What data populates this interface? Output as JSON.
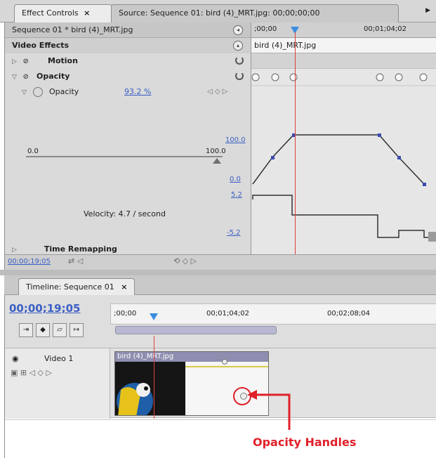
{
  "top_tabs": {
    "active_label": "Effect Controls",
    "active_close": "×",
    "inactive_label": "Source: Sequence 01: bird (4)_MRT.jpg: 00;00;00;00"
  },
  "effect_controls": {
    "sequence_label": "Sequence 01 * bird (4)_MRT.jpg",
    "ruler_start": ";00;00",
    "ruler_end": "00;01;04;02",
    "clip_name": "bird (4)_MRT.jpg",
    "video_effects_header": "Video Effects",
    "motion_label": "Motion",
    "opacity_section_label": "Opacity",
    "opacity_prop_label": "Opacity",
    "opacity_value": "93.2 %",
    "range_min": "0.0",
    "range_max": "100.0",
    "graph_top": "100.0",
    "graph_bottom": "0.0",
    "velocity_top": "5.2",
    "velocity_bottom": "-5.2",
    "velocity_text": "Velocity: 4.7 / second",
    "time_remapping_label": "Time Remapping",
    "current_time": "00;00;19;05"
  },
  "timeline": {
    "tab_label": "Timeline: Sequence 01",
    "tab_close": "×",
    "current_time": "00;00;19;05",
    "ruler_labels": [
      ";00;00",
      "00;01;04;02",
      "00;02;08;04"
    ],
    "track_name": "Video 1",
    "clip_name": "bird (4)_MRT.jpg"
  },
  "annotation": {
    "label": "Opacity Handles",
    "color": "#e0202a"
  },
  "colors": {
    "link_blue": "#3b5fc4",
    "playhead_red": "#e04040",
    "playhead_blue": "#3b8de0"
  }
}
